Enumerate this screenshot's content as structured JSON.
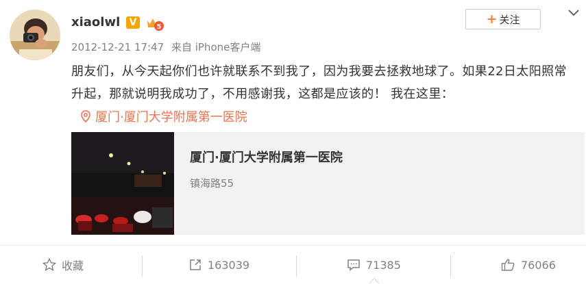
{
  "user": {
    "name": "xiaolwl",
    "verified_badge": "V",
    "vip_level": "5"
  },
  "post": {
    "date": "2012-12-21 17:47",
    "source": "来自 iPhone客户端",
    "text": "朋友们，从今天起你们也许就联系不到我了，因为我要去拯救地球了。如果22日太阳照常升起，那就说明我成功了，不用感谢我，这都是应该的！ 我在这里：",
    "location": "厦门·厦门大学附属第一医院"
  },
  "follow_button": {
    "label": "关注"
  },
  "location_card": {
    "title": "厦门·厦门大学附属第一医院",
    "address": "镇海路55"
  },
  "actions": {
    "favorite": "收藏",
    "repost": "163039",
    "comment": "71385",
    "like": "76066"
  },
  "colors": {
    "accent_orange": "#ff8140",
    "location_red": "#eb7350",
    "muted_gray": "#808080",
    "card_bg": "#f2f2f2"
  },
  "icons": [
    "avatar-photo",
    "verified-v-icon",
    "vip-crown-icon",
    "plus-icon",
    "chevron-down-icon",
    "location-pin-icon",
    "star-icon",
    "share-icon",
    "comment-icon",
    "thumbs-up-icon"
  ]
}
